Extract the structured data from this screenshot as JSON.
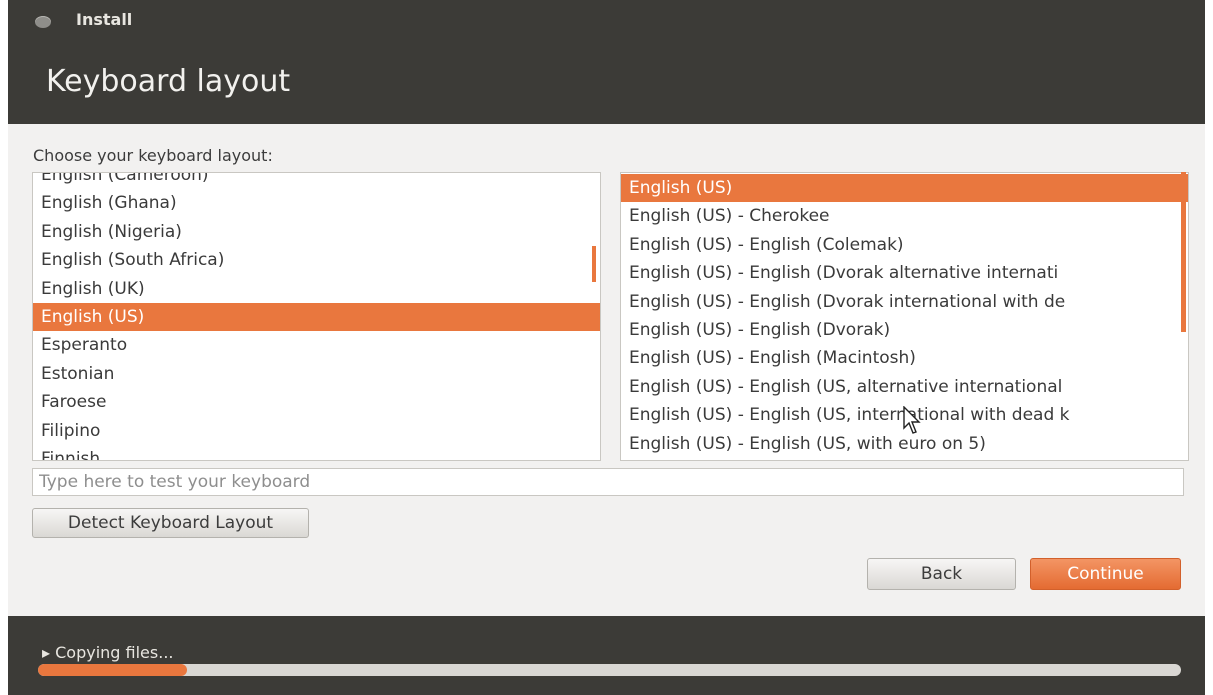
{
  "window": {
    "title": "Install"
  },
  "page": {
    "title": "Keyboard layout"
  },
  "prompt": "Choose your keyboard layout:",
  "left_list": {
    "items": [
      "English (Cameroon)",
      "English (Ghana)",
      "English (Nigeria)",
      "English (South Africa)",
      "English (UK)",
      "English (US)",
      "Esperanto",
      "Estonian",
      "Faroese",
      "Filipino",
      "Finnish"
    ],
    "selected": "English (US)"
  },
  "right_list": {
    "items": [
      "English (US)",
      "English (US) - Cherokee",
      "English (US) - English (Colemak)",
      "English (US) - English (Dvorak alternative internati",
      "English (US) - English (Dvorak international with de",
      "English (US) - English (Dvorak)",
      "English (US) - English (Macintosh)",
      "English (US) - English (US, alternative international",
      "English (US) - English (US, international with dead k",
      "English (US) - English (US, with euro on 5)"
    ],
    "selected": "English (US)"
  },
  "test_field": {
    "placeholder": "Type here to test your keyboard",
    "value": ""
  },
  "buttons": {
    "detect": "Detect Keyboard Layout",
    "back": "Back",
    "continue": "Continue"
  },
  "status": {
    "label": "▸ Copying files...",
    "progress": 0.13
  },
  "colors": {
    "accent": "#e9773e",
    "dark": "#3c3b37"
  }
}
